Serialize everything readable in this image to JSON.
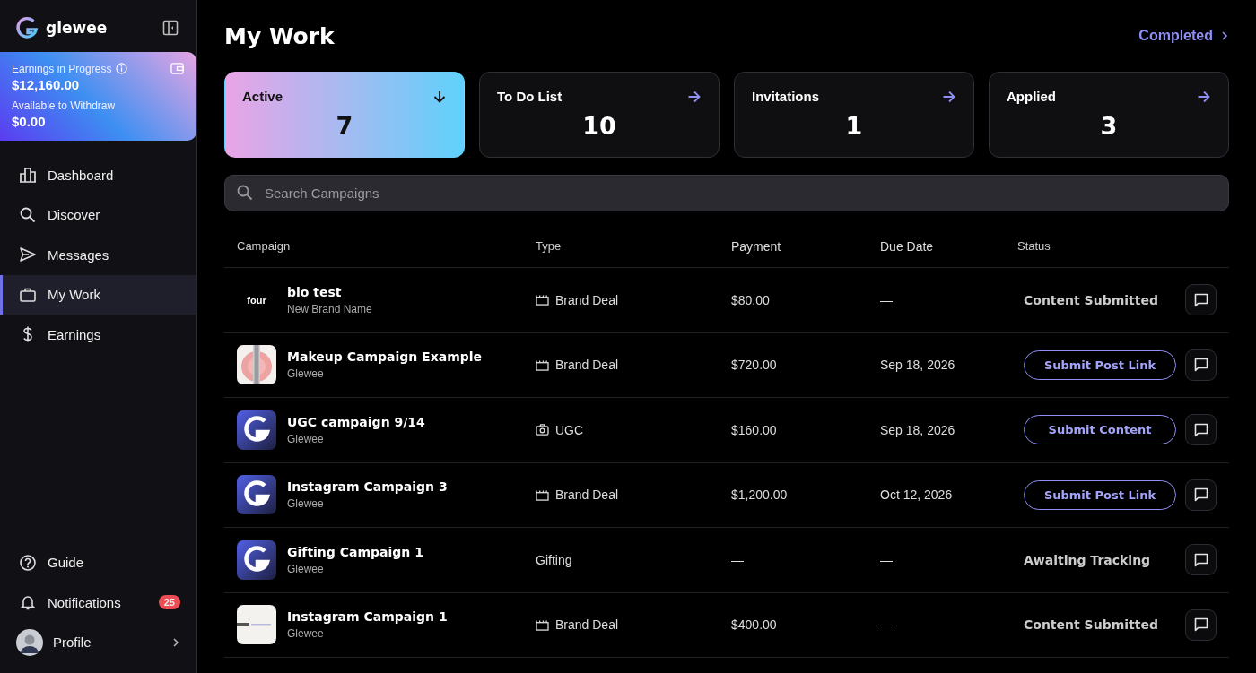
{
  "brand": {
    "name": "glewee"
  },
  "earnings": {
    "label": "Earnings in Progress",
    "amount": "$12,160.00",
    "withdraw_label": "Available to Withdraw",
    "withdraw_amount": "$0.00"
  },
  "nav": [
    {
      "label": "Dashboard",
      "kind": "dashboard",
      "selected": false
    },
    {
      "label": "Discover",
      "kind": "discover",
      "selected": false
    },
    {
      "label": "Messages",
      "kind": "messages",
      "selected": false
    },
    {
      "label": "My Work",
      "kind": "work",
      "selected": true
    },
    {
      "label": "Earnings",
      "kind": "earnings",
      "selected": false
    }
  ],
  "bottom_nav": [
    {
      "label": "Guide",
      "kind": "guide"
    },
    {
      "label": "Notifications",
      "kind": "notifications",
      "badge": "25"
    },
    {
      "label": "Profile",
      "kind": "profile"
    }
  ],
  "page": {
    "title": "My Work",
    "completed_link": "Completed"
  },
  "stats": [
    {
      "label": "Active",
      "value": "7",
      "selected": true
    },
    {
      "label": "To Do List",
      "value": "10",
      "selected": false
    },
    {
      "label": "Invitations",
      "value": "1",
      "selected": false
    },
    {
      "label": "Applied",
      "value": "3",
      "selected": false
    }
  ],
  "search": {
    "placeholder": "Search Campaigns"
  },
  "table": {
    "columns": [
      "Campaign",
      "Type",
      "Payment",
      "Due Date",
      "Status"
    ],
    "rows": [
      {
        "logo": {
          "kind": "wordmark",
          "text": "four"
        },
        "title": "bio test",
        "brand": "New Brand Name",
        "type": {
          "label": "Brand Deal",
          "kind": "brand_deal"
        },
        "payment": "$80.00",
        "due": "—",
        "status": {
          "kind": "text",
          "label": "Content Submitted"
        }
      },
      {
        "title": "Makeup Campaign Example",
        "brand": "Glewee",
        "type": {
          "label": "Brand Deal",
          "kind": "brand_deal"
        },
        "payment": "$720.00",
        "due": "Sep 18, 2026",
        "status": {
          "kind": "action",
          "label": "Submit Post Link"
        }
      },
      {
        "logo": {
          "kind": "glewee"
        },
        "title": "UGC campaign 9/14",
        "brand": "Glewee",
        "type": {
          "label": "UGC",
          "kind": "ugc"
        },
        "payment": "$160.00",
        "due": "Sep 18, 2026",
        "status": {
          "kind": "action",
          "label": "Submit Content"
        }
      },
      {
        "logo": {
          "kind": "glewee"
        },
        "title": "Instagram Campaign 3",
        "brand": "Glewee",
        "type": {
          "label": "Brand Deal",
          "kind": "brand_deal"
        },
        "payment": "$1,200.00",
        "due": "Oct 12, 2026",
        "status": {
          "kind": "action",
          "label": "Submit Post Link"
        }
      },
      {
        "logo": {
          "kind": "glewee"
        },
        "title": "Gifting Campaign 1",
        "brand": "Glewee",
        "type": {
          "label": "Gifting",
          "kind": "gifting"
        },
        "payment": "—",
        "due": "—",
        "status": {
          "kind": "text",
          "label": "Awaiting Tracking"
        }
      },
      {
        "logo": {
          "kind": "card"
        },
        "title": "Instagram Campaign 1",
        "brand": "Glewee",
        "type": {
          "label": "Brand Deal",
          "kind": "brand_deal"
        },
        "payment": "$400.00",
        "due": "—",
        "status": {
          "kind": "text",
          "label": "Content Submitted"
        }
      }
    ]
  }
}
